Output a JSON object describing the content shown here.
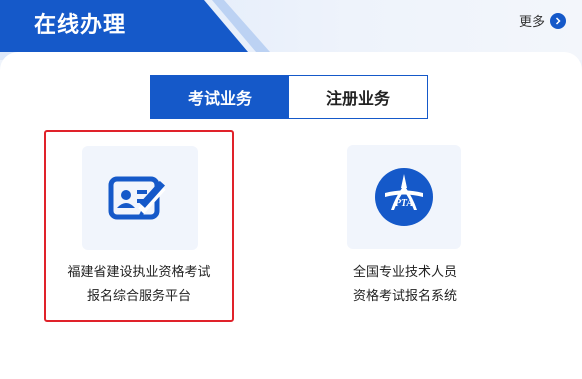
{
  "header": {
    "title": "在线办理",
    "more_label": "更多",
    "more_icon": "chevron-right-icon"
  },
  "tabs": [
    {
      "label": "考试业务",
      "active": true
    },
    {
      "label": "注册业务",
      "active": false
    }
  ],
  "cards": [
    {
      "icon": "id-card-edit-icon",
      "line1": "福建省建设执业资格考试",
      "line2": "报名综合服务平台",
      "highlighted": true
    },
    {
      "icon": "pta-logo",
      "logo_text": "PTA",
      "line1": "全国专业技术人员",
      "line2": "资格考试报名系统",
      "highlighted": false
    }
  ],
  "colors": {
    "brand_blue": "#1559c9",
    "highlight_red": "#e0222a"
  }
}
